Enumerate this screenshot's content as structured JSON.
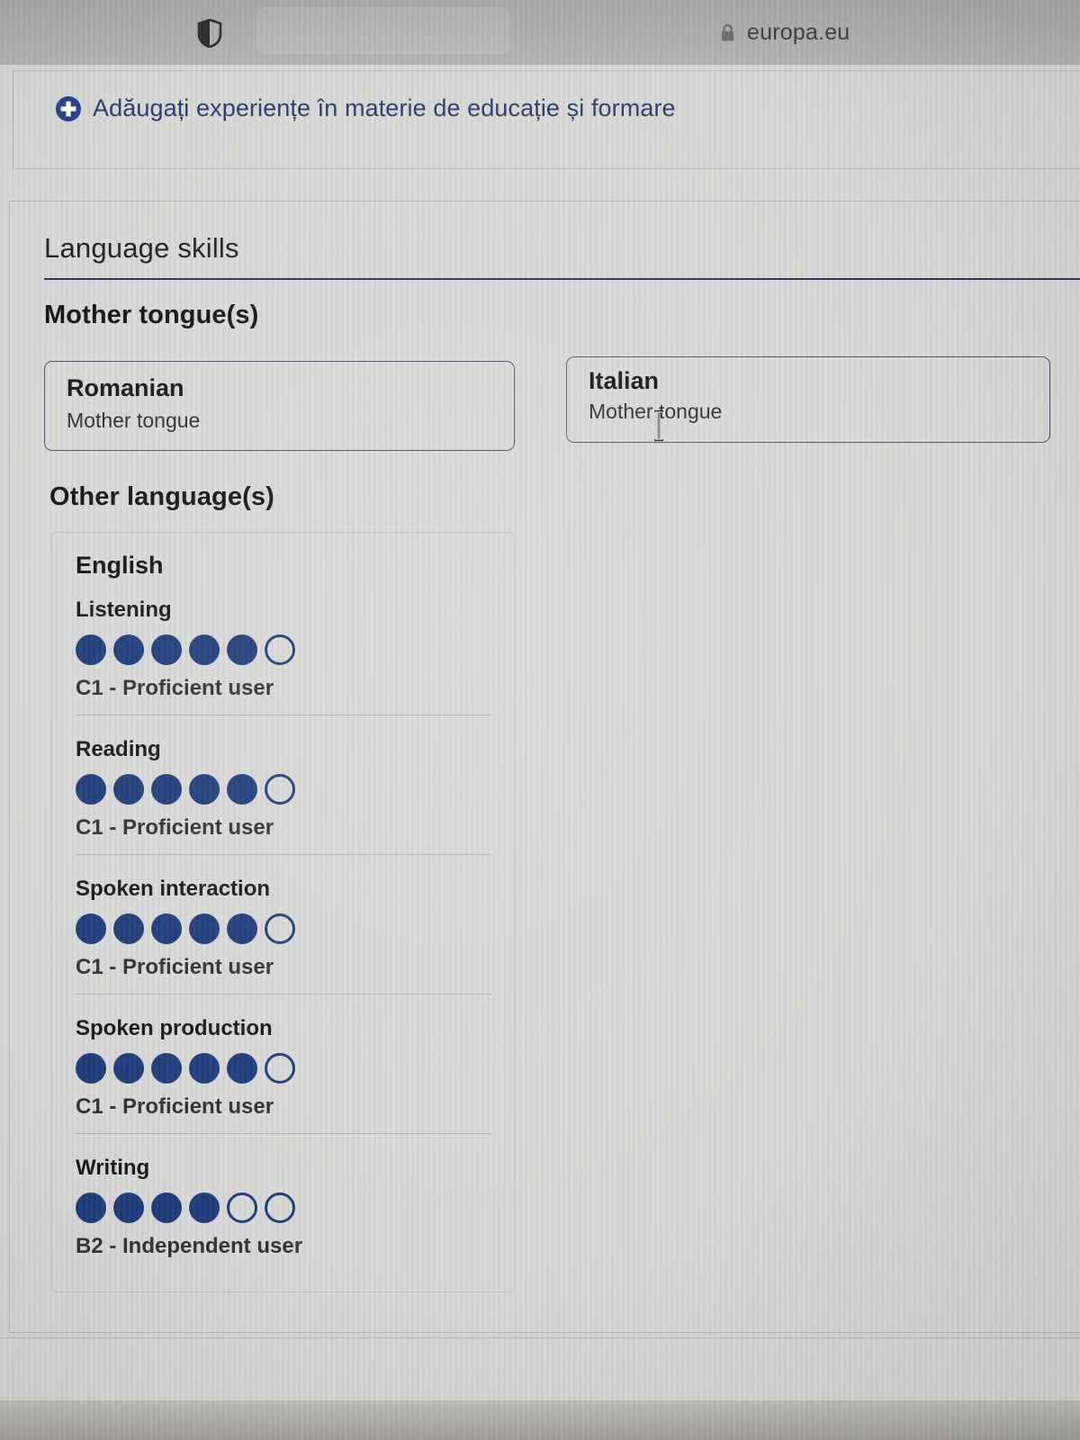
{
  "browser": {
    "shield_icon": "shield-icon",
    "reader_pill": "reader-pill",
    "lock_icon": "lock-icon",
    "url": "europa.eu"
  },
  "add_experience": {
    "icon": "plus-circle-icon",
    "label": "Adăugați experiențe în materie de educație și formare"
  },
  "language_skills": {
    "title": "Language skills",
    "mother_tongue_heading": "Mother tongue(s)",
    "mother_tongues": [
      {
        "name": "Romanian",
        "subtitle": "Mother tongue"
      },
      {
        "name": "Italian",
        "subtitle": "Mother tongue"
      }
    ],
    "other_languages_heading": "Other language(s)",
    "other_languages": [
      {
        "name": "English",
        "skills": [
          {
            "label": "Listening",
            "filled": 5,
            "total": 6,
            "level": "C1 - Proficient user"
          },
          {
            "label": "Reading",
            "filled": 5,
            "total": 6,
            "level": "C1 - Proficient user"
          },
          {
            "label": "Spoken interaction",
            "filled": 5,
            "total": 6,
            "level": "C1 - Proficient user"
          },
          {
            "label": "Spoken production",
            "filled": 5,
            "total": 6,
            "level": "C1 - Proficient user"
          },
          {
            "label": "Writing",
            "filled": 4,
            "total": 6,
            "level": "B2 - Independent user"
          }
        ]
      }
    ]
  },
  "colors": {
    "dot_filled": "#1d3b7a",
    "accent_blue": "#2b3a6b",
    "rule_navy": "#2c3557",
    "card_border": "#4a5270",
    "page_bg": "#d7d8d5"
  },
  "cursor": {
    "type": "text-ibeam"
  }
}
